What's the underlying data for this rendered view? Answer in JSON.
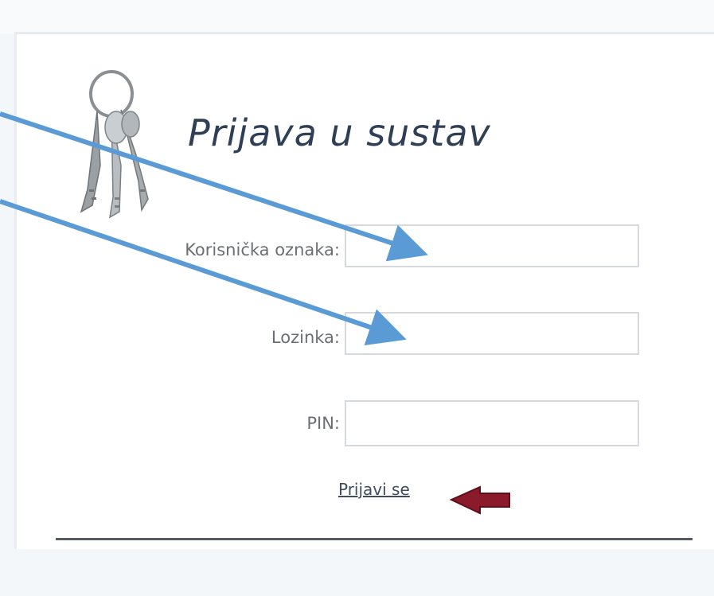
{
  "login": {
    "title": "Prijava u sustav",
    "username_label": "Korisnička oznaka:",
    "username_value": "",
    "password_label": "Lozinka:",
    "password_value": "",
    "pin_label": "PIN:",
    "pin_value": "",
    "submit_label": "Prijavi se"
  },
  "icons": {
    "header_icon": "keys-icon"
  },
  "annotations": {
    "pointer_arrow_color": "#5b9bd5",
    "submit_arrow_color": "#8b1a2b"
  },
  "colors": {
    "title": "#2f3f55",
    "label": "#6b6f74",
    "input_border": "#d6d9dc",
    "divider": "#555b60"
  }
}
